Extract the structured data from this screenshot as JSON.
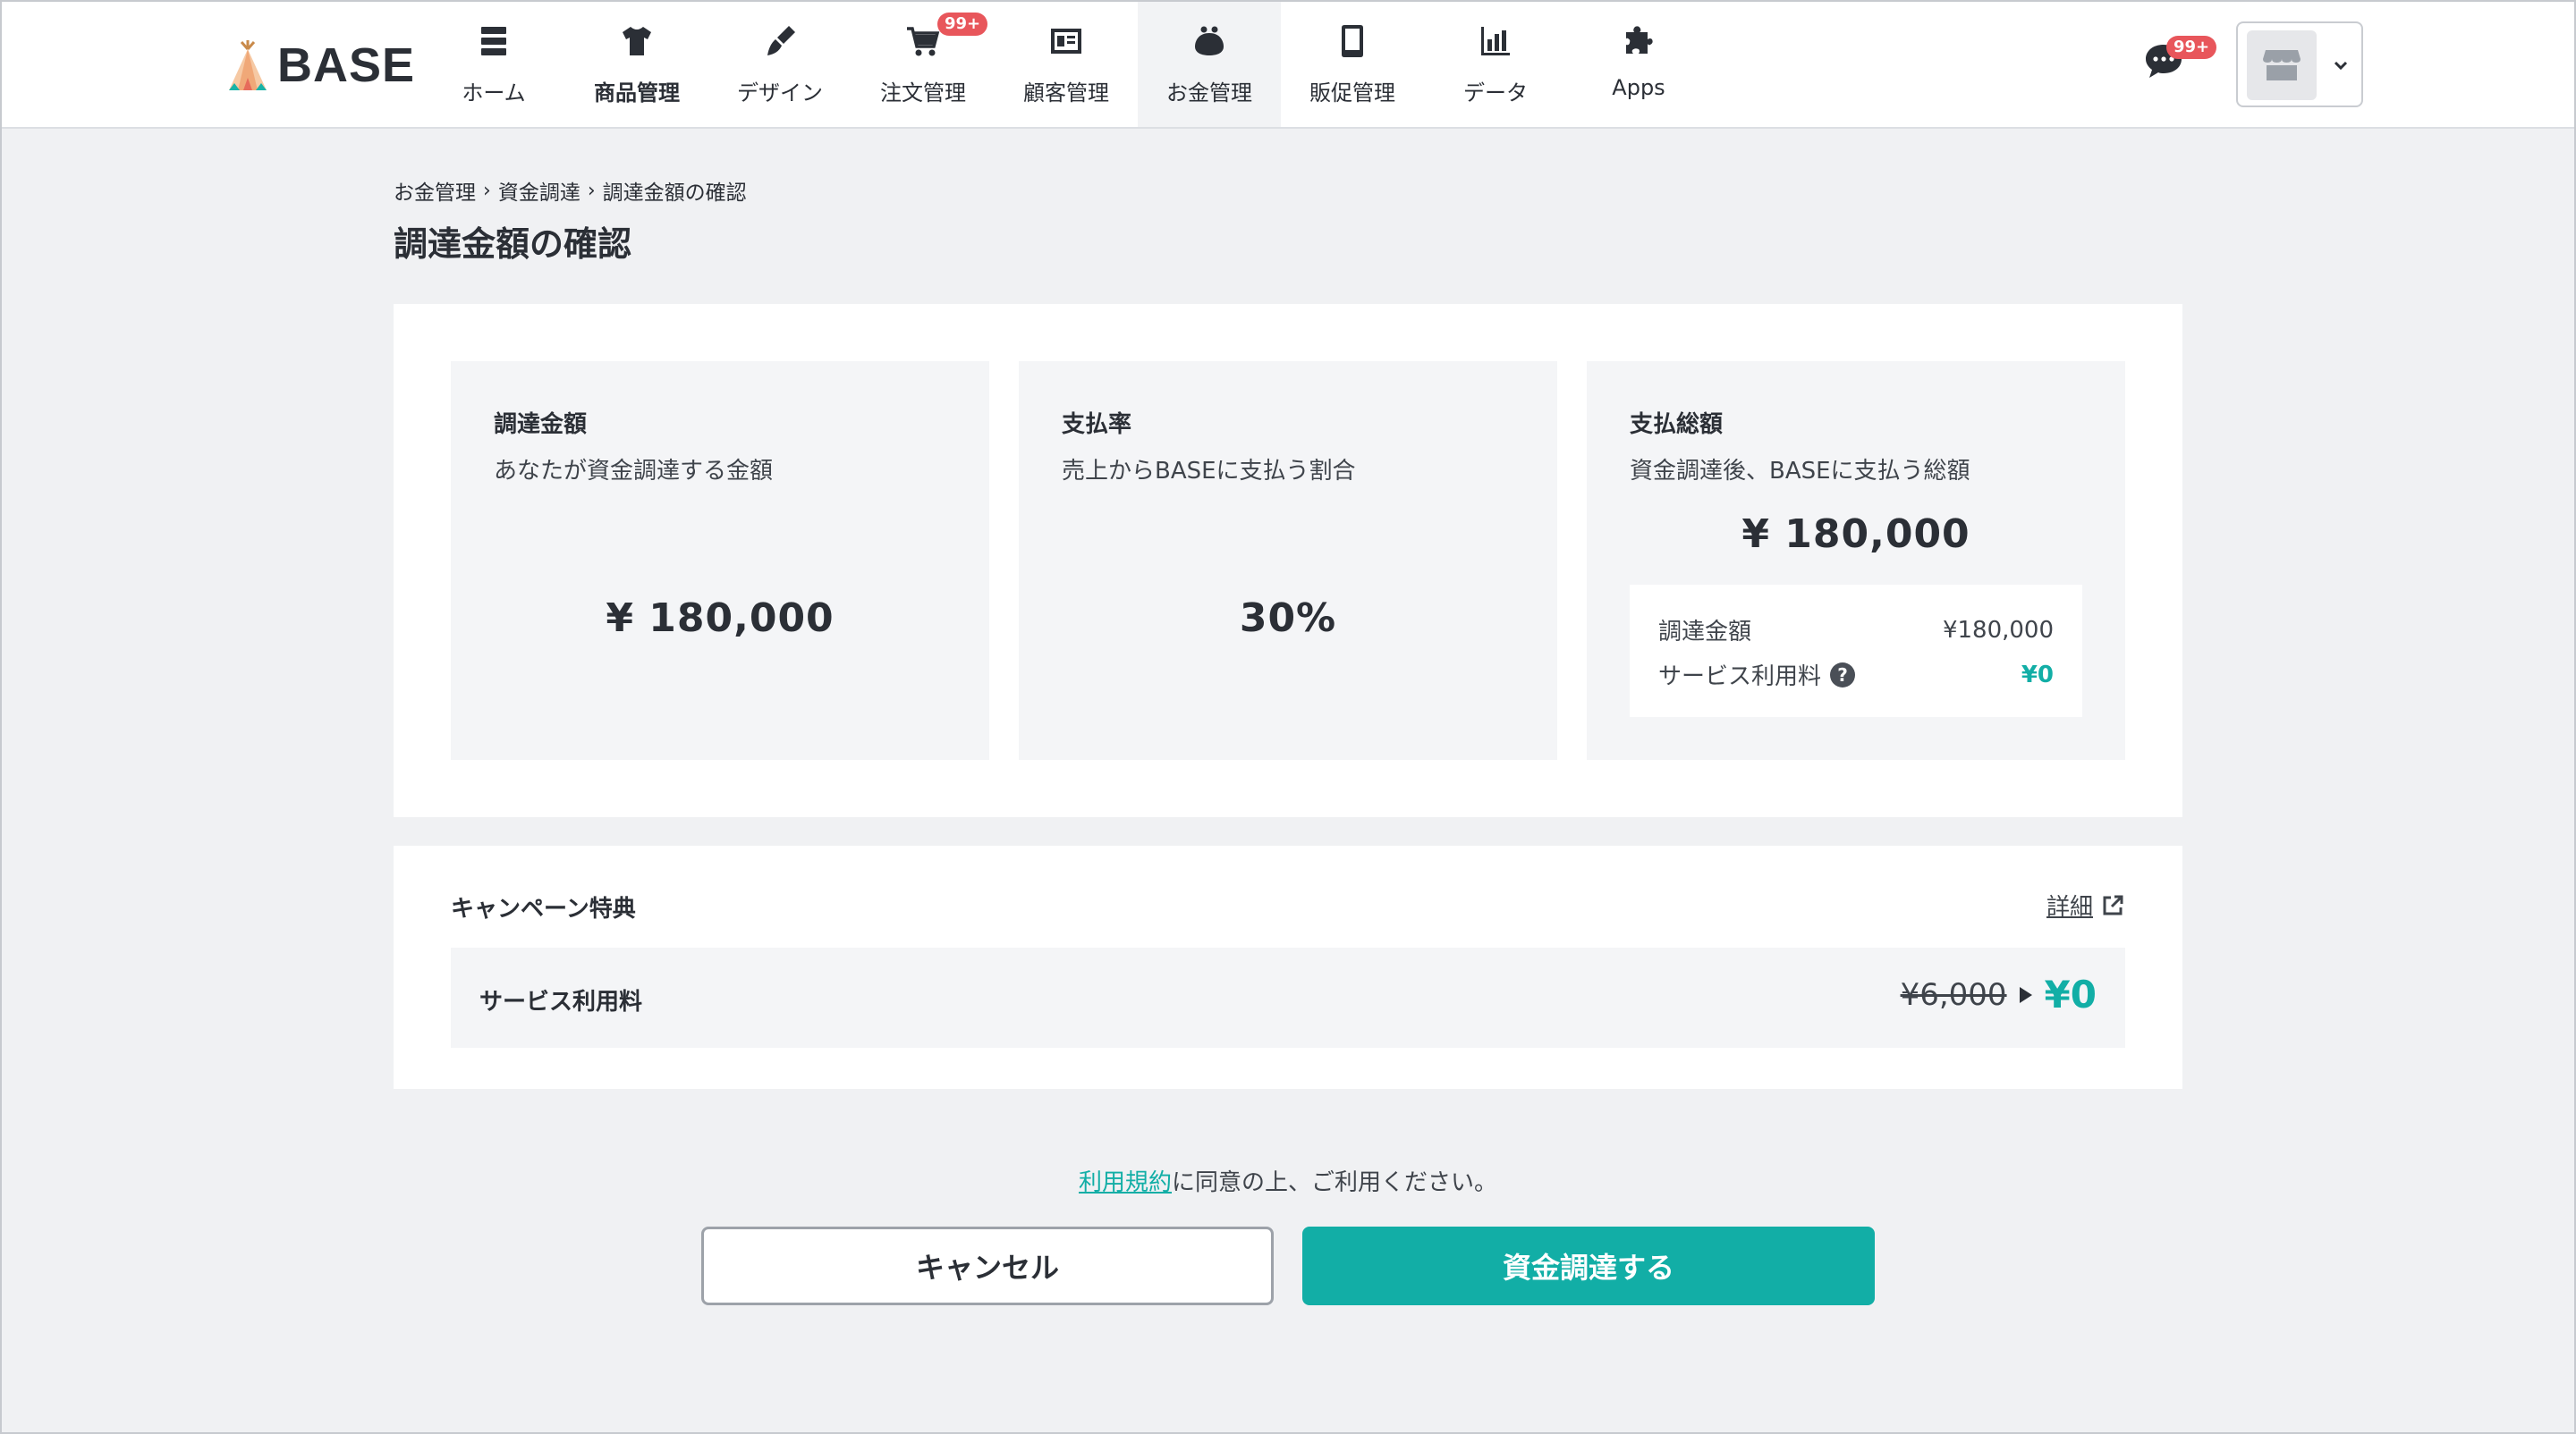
{
  "brand": {
    "name": "BASE"
  },
  "nav": [
    {
      "label": "ホーム",
      "icon": "server-icon",
      "bold": false
    },
    {
      "label": "商品管理",
      "icon": "tshirt-icon",
      "bold": true
    },
    {
      "label": "デザイン",
      "icon": "brush-icon",
      "bold": false
    },
    {
      "label": "注文管理",
      "icon": "cart-icon",
      "bold": false,
      "badge": "99+"
    },
    {
      "label": "顧客管理",
      "icon": "address-card-icon",
      "bold": false
    },
    {
      "label": "お金管理",
      "icon": "purse-icon",
      "bold": false,
      "active": true
    },
    {
      "label": "販促管理",
      "icon": "smartphone-icon",
      "bold": false
    },
    {
      "label": "データ",
      "icon": "bar-chart-icon",
      "bold": false
    },
    {
      "label": "Apps",
      "icon": "puzzle-icon",
      "bold": false
    }
  ],
  "header": {
    "chat_badge": "99+"
  },
  "breadcrumb": {
    "items": [
      "お金管理",
      "資金調達",
      "調達金額の確認"
    ],
    "separator": "›"
  },
  "page": {
    "title": "調達金額の確認"
  },
  "cards": {
    "amount": {
      "title": "調達金額",
      "desc": "あなたが資金調達する金額",
      "value": "¥ 180,000"
    },
    "rate": {
      "title": "支払率",
      "desc": "売上からBASEに支払う割合",
      "value": "30%"
    },
    "total": {
      "title": "支払総額",
      "desc": "資金調達後、BASEに支払う総額",
      "value": "¥ 180,000",
      "breakdown": [
        {
          "label": "調達金額",
          "value": "¥180,000"
        },
        {
          "label": "サービス利用料",
          "value": "¥0",
          "help": "?"
        }
      ]
    }
  },
  "campaign": {
    "title": "キャンペーン特典",
    "detail_link": "詳細",
    "row_label": "サービス利用料",
    "old_price": "¥6,000",
    "new_price": "¥0"
  },
  "footer": {
    "terms_link": "利用規約",
    "terms_text": "に同意の上、ご利用ください。",
    "cancel_label": "キャンセル",
    "submit_label": "資金調達する"
  },
  "colors": {
    "accent": "#12aea6",
    "badge": "#e8565b",
    "text": "#2b2f36",
    "background": "#f0f1f3"
  }
}
